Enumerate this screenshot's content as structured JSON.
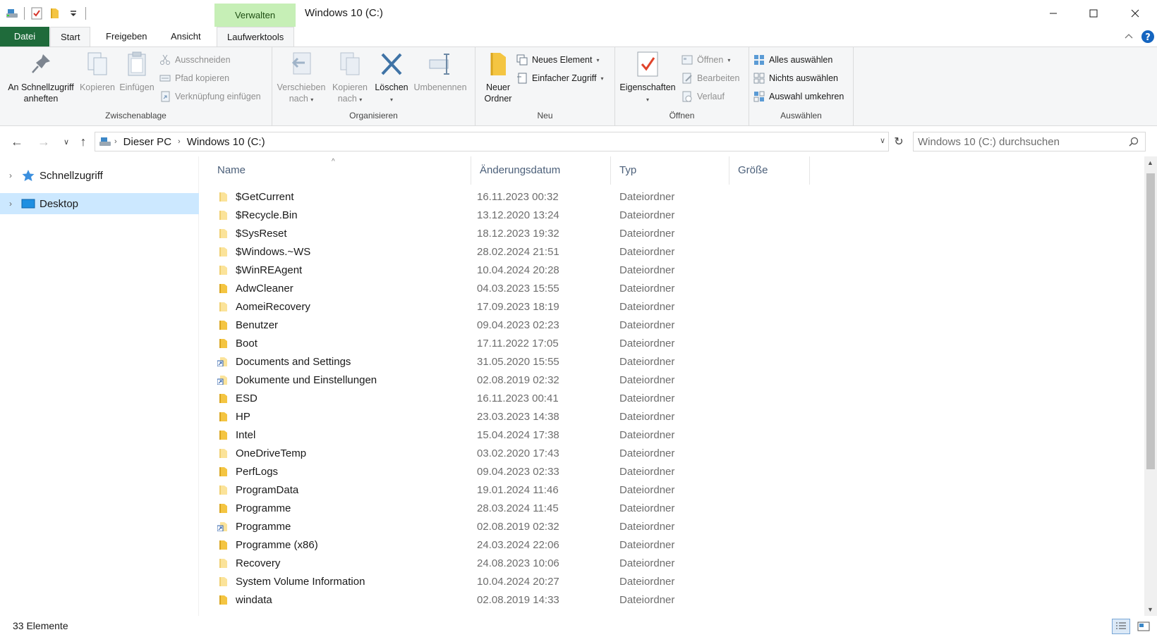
{
  "window": {
    "title": "Windows 10 (C:)",
    "context_tab": "Verwalten",
    "accent_color": "#1f6b3b",
    "context_color": "#c6efb6"
  },
  "ribbon_tabs": {
    "datei": "Datei",
    "start": "Start",
    "freigeben": "Freigeben",
    "ansicht": "Ansicht",
    "laufwerktools": "Laufwerktools"
  },
  "ribbon": {
    "zwischenablage": {
      "label": "Zwischenablage",
      "pin": "An Schnellzugriff anheften",
      "copy": "Kopieren",
      "paste": "Einfügen",
      "cut": "Ausschneiden",
      "copy_path": "Pfad kopieren",
      "paste_shortcut": "Verknüpfung einfügen"
    },
    "organisieren": {
      "label": "Organisieren",
      "move_to": "Verschieben nach",
      "copy_to": "Kopieren nach",
      "delete": "Löschen",
      "rename": "Umbenennen"
    },
    "neu": {
      "label": "Neu",
      "new_folder": "Neuer Ordner",
      "new_item": "Neues Element",
      "easy_access": "Einfacher Zugriff"
    },
    "oeffnen": {
      "label": "Öffnen",
      "properties": "Eigenschaften",
      "open": "Öffnen",
      "edit": "Bearbeiten",
      "history": "Verlauf"
    },
    "auswaehlen": {
      "label": "Auswählen",
      "select_all": "Alles auswählen",
      "select_none": "Nichts auswählen",
      "invert": "Auswahl umkehren"
    }
  },
  "address": {
    "crumbs": [
      "Dieser PC",
      "Windows 10 (C:)"
    ],
    "search_placeholder": "Windows 10 (C:) durchsuchen"
  },
  "nav_pane": {
    "items": [
      "Schnellzugriff",
      "Desktop"
    ]
  },
  "columns": [
    "Name",
    "Änderungsdatum",
    "Typ",
    "Größe"
  ],
  "files": [
    {
      "name": "$GetCurrent",
      "date": "16.11.2023 00:32",
      "type": "Dateiordner",
      "icon": "folder-faded"
    },
    {
      "name": "$Recycle.Bin",
      "date": "13.12.2020 13:24",
      "type": "Dateiordner",
      "icon": "folder-faded"
    },
    {
      "name": "$SysReset",
      "date": "18.12.2023 19:32",
      "type": "Dateiordner",
      "icon": "folder-faded"
    },
    {
      "name": "$Windows.~WS",
      "date": "28.02.2024 21:51",
      "type": "Dateiordner",
      "icon": "folder-faded"
    },
    {
      "name": "$WinREAgent",
      "date": "10.04.2024 20:28",
      "type": "Dateiordner",
      "icon": "folder-faded"
    },
    {
      "name": "AdwCleaner",
      "date": "04.03.2023 15:55",
      "type": "Dateiordner",
      "icon": "folder"
    },
    {
      "name": "AomeiRecovery",
      "date": "17.09.2023 18:19",
      "type": "Dateiordner",
      "icon": "folder-faded"
    },
    {
      "name": "Benutzer",
      "date": "09.04.2023 02:23",
      "type": "Dateiordner",
      "icon": "folder"
    },
    {
      "name": "Boot",
      "date": "17.11.2022 17:05",
      "type": "Dateiordner",
      "icon": "folder"
    },
    {
      "name": "Documents and Settings",
      "date": "31.05.2020 15:55",
      "type": "Dateiordner",
      "icon": "shortcut"
    },
    {
      "name": "Dokumente und Einstellungen",
      "date": "02.08.2019 02:32",
      "type": "Dateiordner",
      "icon": "shortcut"
    },
    {
      "name": "ESD",
      "date": "16.11.2023 00:41",
      "type": "Dateiordner",
      "icon": "folder"
    },
    {
      "name": "HP",
      "date": "23.03.2023 14:38",
      "type": "Dateiordner",
      "icon": "folder"
    },
    {
      "name": "Intel",
      "date": "15.04.2024 17:38",
      "type": "Dateiordner",
      "icon": "folder"
    },
    {
      "name": "OneDriveTemp",
      "date": "03.02.2020 17:43",
      "type": "Dateiordner",
      "icon": "folder-faded"
    },
    {
      "name": "PerfLogs",
      "date": "09.04.2023 02:33",
      "type": "Dateiordner",
      "icon": "folder"
    },
    {
      "name": "ProgramData",
      "date": "19.01.2024 11:46",
      "type": "Dateiordner",
      "icon": "folder-faded"
    },
    {
      "name": "Programme",
      "date": "28.03.2024 11:45",
      "type": "Dateiordner",
      "icon": "folder"
    },
    {
      "name": "Programme",
      "date": "02.08.2019 02:32",
      "type": "Dateiordner",
      "icon": "shortcut"
    },
    {
      "name": "Programme (x86)",
      "date": "24.03.2024 22:06",
      "type": "Dateiordner",
      "icon": "folder"
    },
    {
      "name": "Recovery",
      "date": "24.08.2023 10:06",
      "type": "Dateiordner",
      "icon": "folder-faded"
    },
    {
      "name": "System Volume Information",
      "date": "10.04.2024 20:27",
      "type": "Dateiordner",
      "icon": "folder-faded"
    },
    {
      "name": "windata",
      "date": "02.08.2019 14:33",
      "type": "Dateiordner",
      "icon": "folder"
    }
  ],
  "status": {
    "count": "33 Elemente"
  }
}
